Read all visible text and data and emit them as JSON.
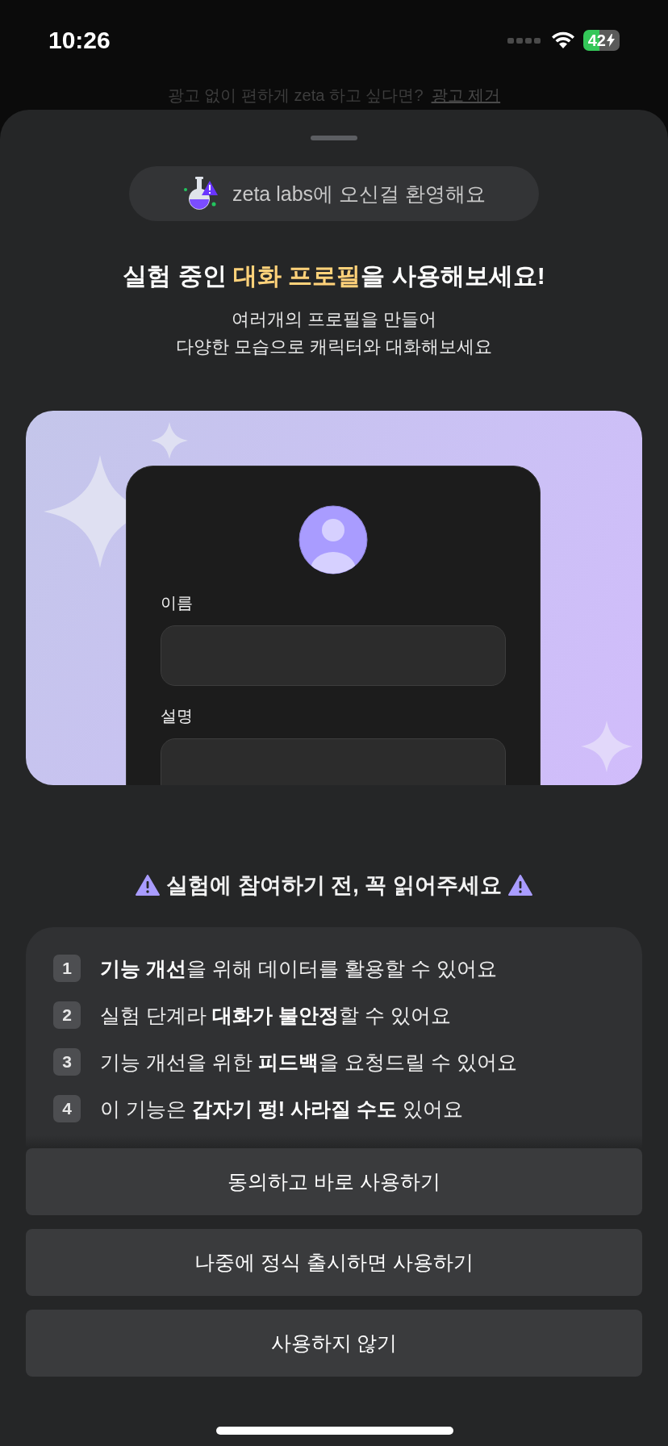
{
  "status_bar": {
    "time": "10:26",
    "battery": "42"
  },
  "ad_banner": {
    "text": "광고 없이 편하게 zeta 하고 싶다면?",
    "link": "광고 제거"
  },
  "badge": {
    "text": "zeta labs에 오신걸 환영해요"
  },
  "title_parts": [
    {
      "text": "실험 중인 ",
      "highlight": false
    },
    {
      "text": "대화 프로필",
      "highlight": true
    },
    {
      "text": "을 사용해보세요!",
      "highlight": false
    }
  ],
  "subtitle": [
    "여러개의 프로필을 만들어",
    "다양한 모습으로 캐릭터와 대화해보세요"
  ],
  "illustration": {
    "fields": [
      {
        "label": "이름"
      },
      {
        "label": "설명"
      }
    ]
  },
  "notice": {
    "heading": "실험에 참여하기 전, 꼭 읽어주세요",
    "items": [
      {
        "number": "1",
        "text": "**기능 개선**을 위해 데이터를 활용할 수 있어요"
      },
      {
        "number": "2",
        "text": "실험 단계라 **대화가 불안정**할 수 있어요"
      },
      {
        "number": "3",
        "text": "기능 개선을 위한 **피드백**을 요청드릴 수 있어요"
      },
      {
        "number": "4",
        "text": "이 기능은 **갑자기 펑! 사라질 수도** 있어요"
      }
    ]
  },
  "buttons": [
    "동의하고 바로 사용하기",
    "나중에 정식 출시하면 사용하기",
    "사용하지 않기"
  ]
}
